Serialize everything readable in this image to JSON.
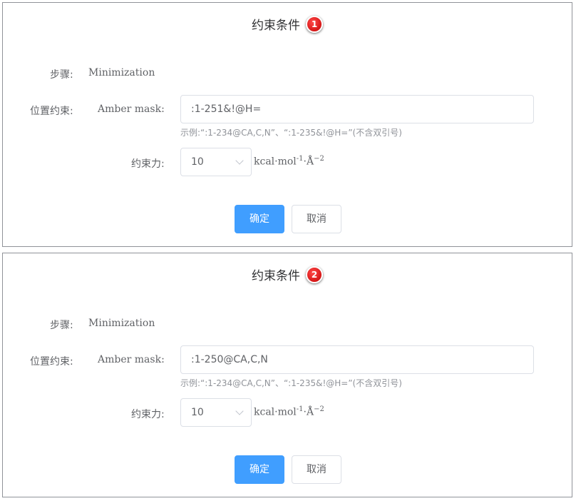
{
  "dialogs": [
    {
      "title": "约束条件",
      "badge": "1",
      "step_label": "步骤:",
      "step_value": "Minimization",
      "position_label": "位置约束:",
      "mask_label": "Amber mask:",
      "mask_value": ":1-251&!@H=",
      "hint": "示例:“:1-234@CA,C,N”、“:1-235&!@H=”(不含双引号)",
      "force_label": "约束力:",
      "force_value": "10",
      "unit_main": "kcal·mol",
      "unit_exp1": "-1",
      "unit_mid": "·Å",
      "unit_exp2": "−2",
      "confirm": "确定",
      "cancel": "取消"
    },
    {
      "title": "约束条件",
      "badge": "2",
      "step_label": "步骤:",
      "step_value": "Minimization",
      "position_label": "位置约束:",
      "mask_label": "Amber mask:",
      "mask_value": ":1-250@CA,C,N",
      "hint": "示例:“:1-234@CA,C,N”、“:1-235&!@H=”(不含双引号)",
      "force_label": "约束力:",
      "force_value": "10",
      "unit_main": "kcal·mol",
      "unit_exp1": "-1",
      "unit_mid": "·Å",
      "unit_exp2": "−2",
      "confirm": "确定",
      "cancel": "取消"
    }
  ],
  "colors": {
    "primary": "#409eff",
    "badge": "#d40000",
    "border": "#dcdfe6",
    "text": "#606266",
    "hint": "#909399"
  }
}
